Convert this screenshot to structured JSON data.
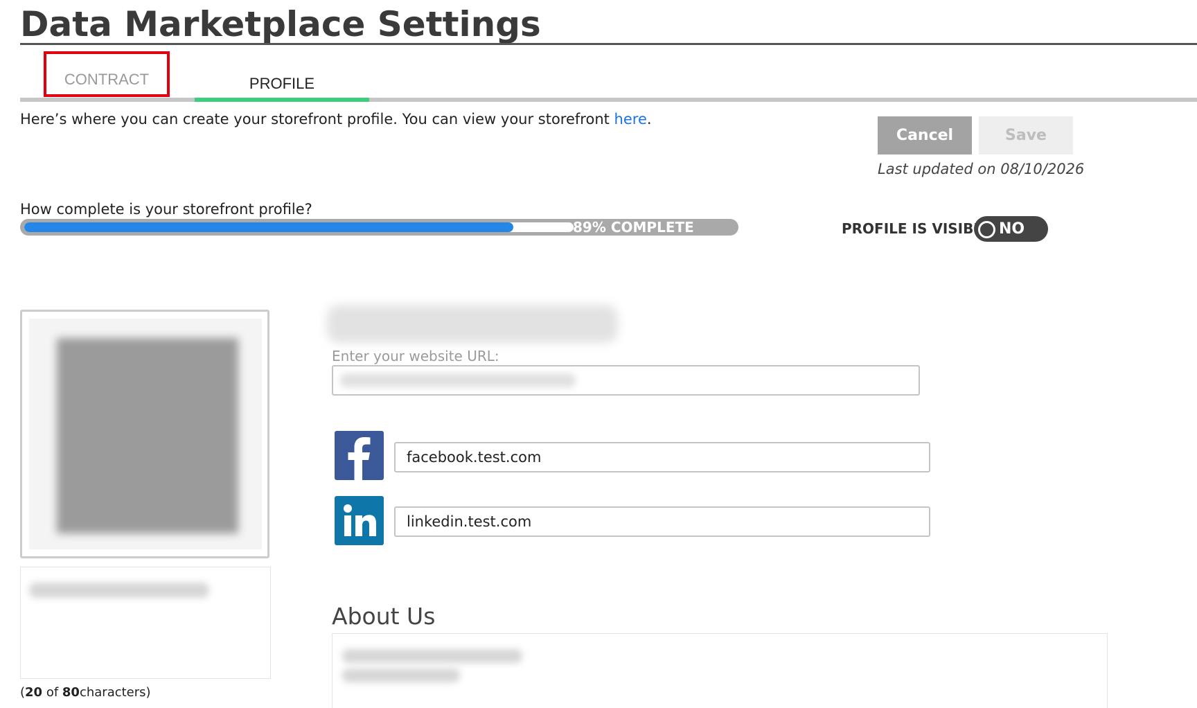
{
  "page": {
    "title": "Data Marketplace Settings"
  },
  "tabs": [
    {
      "label": "CONTRACT"
    },
    {
      "label": "PROFILE",
      "active": true
    }
  ],
  "intro": {
    "text": "Here’s where you can create your storefront profile. You can view your storefront ",
    "link_label": "here",
    "end": "."
  },
  "actions": {
    "cancel_label": "Cancel",
    "save_label": "Save",
    "last_updated": "Last updated on 08/10/2026"
  },
  "completion": {
    "question": "How complete is your storefront profile?",
    "percent": 89,
    "label": "89% COMPLETE"
  },
  "visibility": {
    "label": "PROFILE IS VISIBLE",
    "toggle_value": "NO"
  },
  "form": {
    "website_label": "Enter your website URL:",
    "website_value": "",
    "facebook_value": "facebook.test.com",
    "linkedin_value": "linkedin.test.com",
    "about_heading": "About Us"
  },
  "tagline": {
    "count_prefix": "(",
    "count_current": "20",
    "count_of": " of ",
    "count_max": "80",
    "count_suffix": "characters)"
  },
  "colors": {
    "accent_green": "#3cce7d",
    "link_blue": "#1a73e8",
    "progress_blue": "#2486e6",
    "highlight_red": "#e0000f",
    "facebook_blue": "#3b5998",
    "linkedin_blue": "#0e76a8"
  },
  "icons": {
    "facebook": "facebook-icon",
    "linkedin": "linkedin-icon"
  }
}
